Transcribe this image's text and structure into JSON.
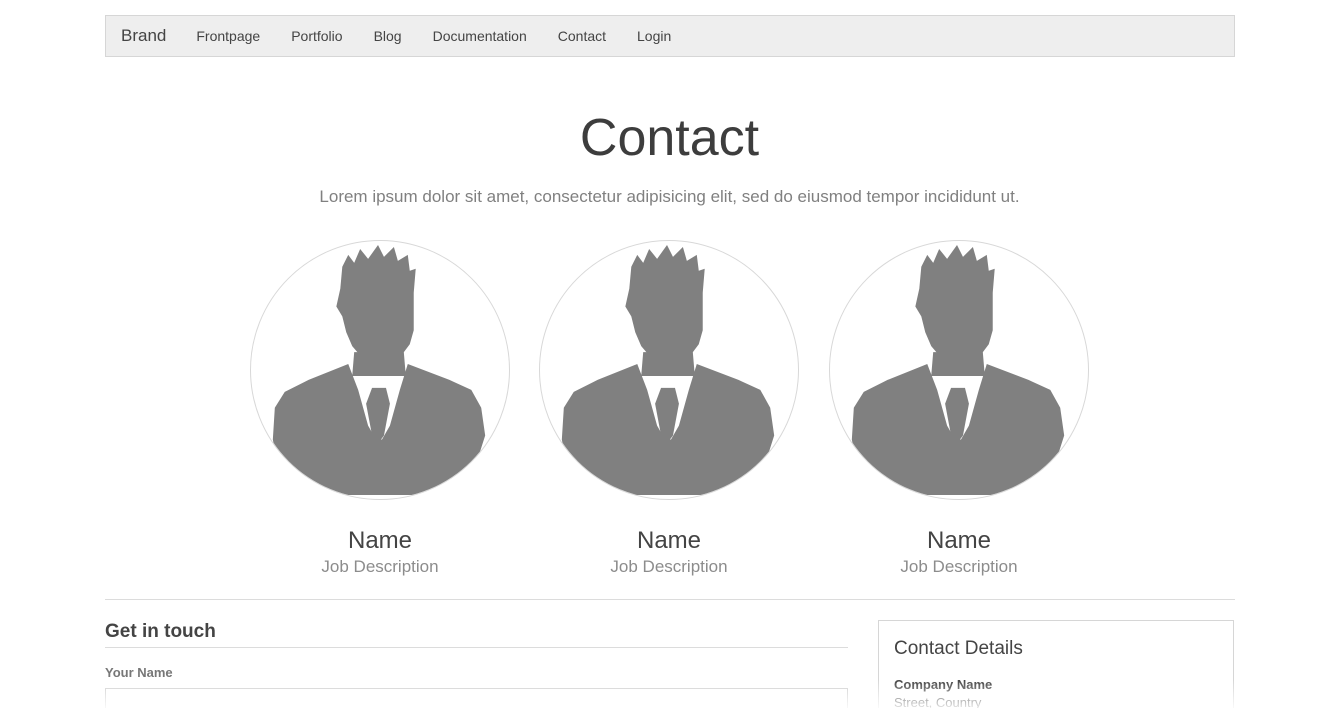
{
  "navbar": {
    "brand": "Brand",
    "links": [
      "Frontpage",
      "Portfolio",
      "Blog",
      "Documentation",
      "Contact",
      "Login"
    ]
  },
  "page": {
    "title": "Contact",
    "lead": "Lorem ipsum dolor sit amet, consectetur adipisicing elit, sed do eiusmod tempor incididunt ut."
  },
  "team": [
    {
      "name": "Name",
      "job": "Job Description"
    },
    {
      "name": "Name",
      "job": "Job Description"
    },
    {
      "name": "Name",
      "job": "Job Description"
    }
  ],
  "form": {
    "title": "Get in touch",
    "name_label": "Your Name",
    "name_value": ""
  },
  "details": {
    "title": "Contact Details",
    "company": "Company Name",
    "street": "Street, Country"
  }
}
